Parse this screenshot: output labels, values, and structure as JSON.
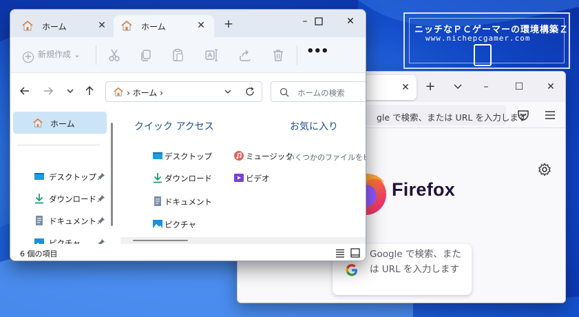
{
  "colors": {
    "wallpaper_dark": "#0a2a9a",
    "wallpaper_light": "#3f86f0",
    "selection": "#cce4f7",
    "section_title": "#1e4e8c",
    "firefox_brand": "#20123a"
  },
  "watermark": {
    "title": "ニッチなＰＣゲーマーの環境構築Ｚ",
    "url": "www.nichepcgamer.com"
  },
  "explorer": {
    "tabs": [
      {
        "label": "ホーム",
        "icon": "home-icon",
        "active": false
      },
      {
        "label": "ホーム",
        "icon": "home-icon",
        "active": true
      }
    ],
    "new_tab": "+",
    "window_controls": {
      "minimize": "–",
      "maximize": "☐",
      "close": "✕"
    },
    "toolbar": {
      "new_label": "新規作成",
      "icons": [
        "cut-icon",
        "copy-icon",
        "paste-icon",
        "rename-icon",
        "share-icon",
        "delete-icon"
      ],
      "more": "•••"
    },
    "address": {
      "path": "›  ホーム  ›"
    },
    "search": {
      "placeholder": "ホームの検索"
    },
    "nav": {
      "home_label": "ホーム",
      "items": [
        {
          "label": "デスクトップ",
          "icon": "desktop-icon",
          "pinned": true
        },
        {
          "label": "ダウンロード",
          "icon": "download-icon",
          "pinned": true
        },
        {
          "label": "ドキュメント",
          "icon": "document-icon",
          "pinned": true
        },
        {
          "label": "ピクチャ",
          "icon": "picture-icon",
          "pinned": true
        }
      ]
    },
    "quick_access": {
      "title": "クイック アクセス",
      "items": [
        {
          "label": "デスクトップ",
          "icon": "desktop-icon"
        },
        {
          "label": "ダウンロード",
          "icon": "download-icon"
        },
        {
          "label": "ドキュメント",
          "icon": "document-icon"
        },
        {
          "label": "ピクチャ",
          "icon": "picture-icon"
        },
        {
          "label": "ミュージック",
          "icon": "music-icon"
        },
        {
          "label": "ビデオ",
          "icon": "video-icon"
        }
      ]
    },
    "favorites": {
      "title": "お気に入り",
      "empty_text": "いくつかのファイルをピン留"
    },
    "status": {
      "item_count": "6 個の項目"
    }
  },
  "firefox": {
    "tab_close": "✕",
    "new_tab": "+",
    "tab_list": "⌄",
    "window_controls": {
      "minimize": "–",
      "maximize": "☐",
      "close": "✕"
    },
    "urlbar_text": "gle で検索、または URL を入力します",
    "brand": "Firefox",
    "search_text": "Google で検索、または URL を入力します"
  }
}
